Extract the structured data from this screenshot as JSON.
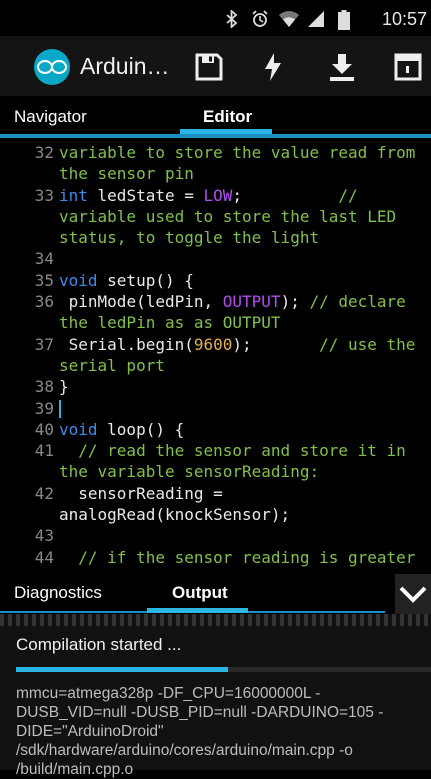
{
  "status_bar": {
    "time": "10:57",
    "icons": [
      "bluetooth-icon",
      "alarm-icon",
      "wifi-icon",
      "signal-icon",
      "battery-icon"
    ]
  },
  "app_bar": {
    "title": "Arduin…",
    "actions": [
      "save-icon",
      "flash-icon",
      "download-icon",
      "serial-monitor-icon"
    ]
  },
  "tabs": {
    "navigator": "Navigator",
    "editor": "Editor",
    "active": "editor"
  },
  "code_lines": [
    {
      "num": "32",
      "segments": [
        [
          "cm",
          "variable to store the value read from the sensor pin"
        ]
      ]
    },
    {
      "num": "33",
      "segments": [
        [
          "kw",
          "int"
        ],
        [
          "pl",
          " ledState = "
        ],
        [
          "cn",
          "LOW"
        ],
        [
          "pl",
          ";          "
        ],
        [
          "cm",
          "// variable used to store the last LED status, to toggle the light"
        ]
      ]
    },
    {
      "num": "34",
      "segments": []
    },
    {
      "num": "35",
      "segments": [
        [
          "kw",
          "void"
        ],
        [
          "pl",
          " setup() {"
        ]
      ]
    },
    {
      "num": "36",
      "segments": [
        [
          "pl",
          " pinMode(ledPin, "
        ],
        [
          "cn",
          "OUTPUT"
        ],
        [
          "pl",
          "); "
        ],
        [
          "cm",
          "// declare the ledPin as as OUTPUT"
        ]
      ]
    },
    {
      "num": "37",
      "segments": [
        [
          "pl",
          " Serial.begin("
        ],
        [
          "nm",
          "9600"
        ],
        [
          "pl",
          ");       "
        ],
        [
          "cm",
          "// use the serial port"
        ]
      ]
    },
    {
      "num": "38",
      "segments": [
        [
          "pl",
          "}"
        ]
      ]
    },
    {
      "num": "39",
      "segments": [],
      "caret": true
    },
    {
      "num": "40",
      "segments": [
        [
          "kw",
          "void"
        ],
        [
          "pl",
          " loop() {"
        ]
      ]
    },
    {
      "num": "41",
      "segments": [
        [
          "pl",
          "  "
        ],
        [
          "cm",
          "// read the sensor and store it in the variable sensorReading:"
        ]
      ]
    },
    {
      "num": "42",
      "segments": [
        [
          "pl",
          "  sensorReading = analogRead(knockSensor);"
        ]
      ]
    },
    {
      "num": "43",
      "segments": []
    },
    {
      "num": "44",
      "segments": [
        [
          "pl",
          "  "
        ],
        [
          "cm",
          "// if the sensor reading is greater"
        ]
      ]
    }
  ],
  "bottom_tabs": {
    "diagnostics": "Diagnostics",
    "output": "Output",
    "active": "output"
  },
  "output": {
    "status": "Compilation started ...",
    "progress": 0.51,
    "log": "mmcu=atmega328p -DF_CPU=16000000L -DUSB_VID=null -DUSB_PID=null -DARDUINO=105 -DIDE=\"ArduinoDroid\" /sdk/hardware/arduino/cores/arduino/main.cpp -o /build/main.cpp.o"
  },
  "colors": {
    "accent": "#2bb4e6",
    "keyword": "#3b8bea",
    "comment": "#80c04a",
    "constant": "#b14cf0",
    "number": "#e6b04a"
  }
}
